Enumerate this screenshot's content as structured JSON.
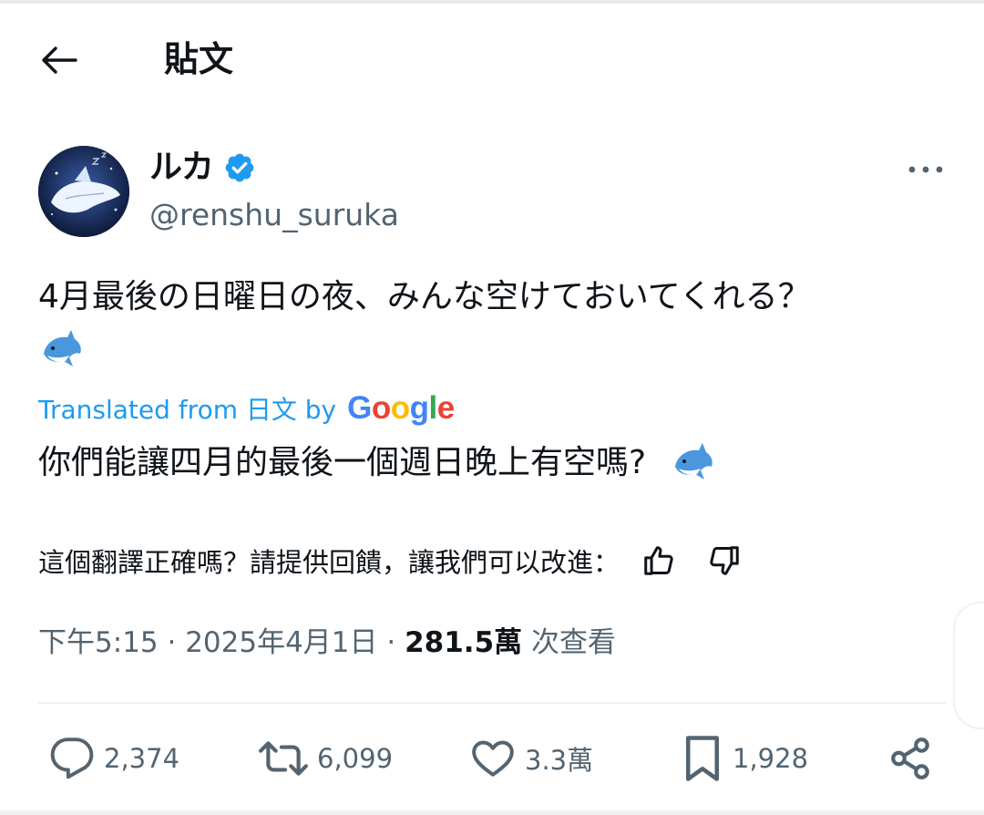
{
  "header": {
    "title": "貼文",
    "back_icon": "arrow-left-icon"
  },
  "author": {
    "name": "ルカ",
    "handle": "@renshu_suruka",
    "verified": true,
    "verified_color": "#1d9bf0"
  },
  "tweet": {
    "text": "4月最後の日曜日の夜、みんな空けておいてくれる？",
    "emoji": "dolphin-emoji",
    "translated_prefix": "Translated from 日文 by",
    "translated_provider": "Google",
    "translation": "你們能讓四月的最後一個週日晚上有空嗎?",
    "feedback_prompt": "這個翻譯正確嗎？請提供回饋，讓我們可以改進："
  },
  "meta": {
    "time": "下午5:15",
    "sep1": " · ",
    "date": "2025年4月1日",
    "sep2": " · ",
    "views": "281.5萬",
    "views_label": " 次查看"
  },
  "actions": {
    "replies": "2,374",
    "reposts": "6,099",
    "likes": "3.3萬",
    "bookmarks": "1,928"
  },
  "colors": {
    "accent": "#1d9bf0",
    "muted": "#536471",
    "text": "#0f1419"
  }
}
